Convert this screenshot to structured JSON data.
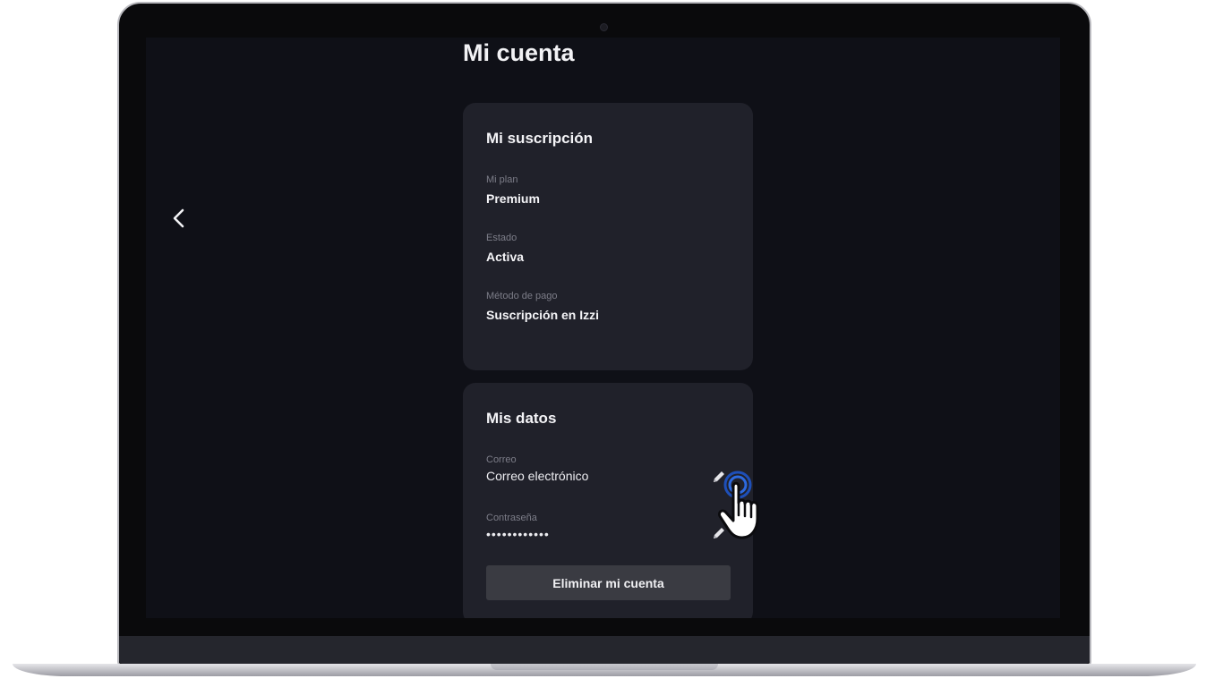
{
  "page": {
    "title": "Mi cuenta",
    "back_icon": "chevron-left-icon"
  },
  "subscription": {
    "title": "Mi suscripción",
    "fields": [
      {
        "label": "Mi plan",
        "value": "Premium"
      },
      {
        "label": "Estado",
        "value": "Activa"
      },
      {
        "label": "Método de pago",
        "value": "Suscripción en Izzi"
      }
    ]
  },
  "my_data": {
    "title": "Mis datos",
    "email": {
      "label": "Correo",
      "value": "Correo electrónico",
      "edit_icon": "pencil-icon"
    },
    "password": {
      "label": "Contraseña",
      "value": "••••••••••••",
      "edit_icon": "pencil-icon"
    },
    "delete_label": "Eliminar mi cuenta"
  },
  "colors": {
    "screen_bg": "#0f1017",
    "card_bg": "#20212a",
    "button_bg": "#3a3b42",
    "cursor_ring": "#1e4fb8"
  }
}
